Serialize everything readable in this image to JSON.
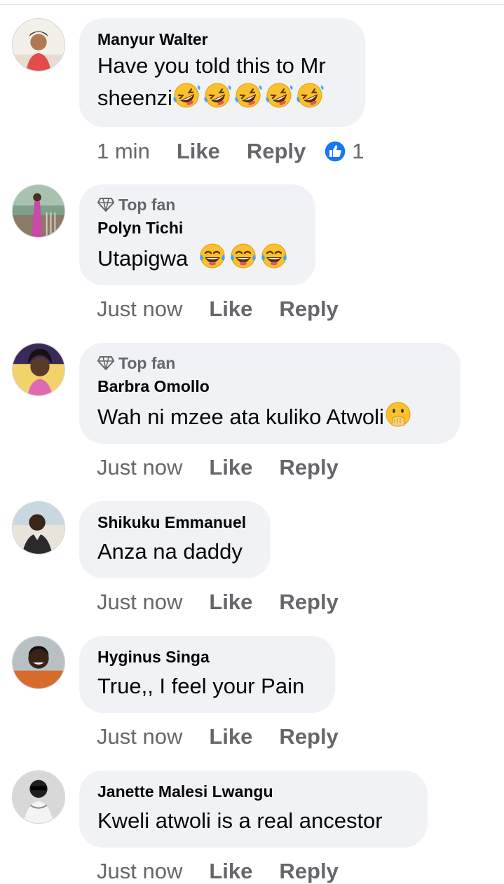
{
  "colors": {
    "bubble": "#f0f2f5",
    "meta_text": "#65676b",
    "name_text": "#050505",
    "like_blue": "#1877f2"
  },
  "comments": [
    {
      "author": "Manyur Walter",
      "top_fan": false,
      "text_lines": [
        "Have you told this to Mr",
        "sheenzi"
      ],
      "emoji": "rolling-on-floor-laughing-icon x5",
      "time": "1 min",
      "like": "Like",
      "reply": "Reply",
      "reactions": "1"
    },
    {
      "author": "Polyn Tichi",
      "top_fan": true,
      "badge": "Top fan",
      "text": "Utapigwa",
      "emoji": "tears-of-joy-icon x3",
      "time": "Just now",
      "like": "Like",
      "reply": "Reply"
    },
    {
      "author": "Barbra Omollo",
      "top_fan": true,
      "badge": "Top fan",
      "text": "Wah ni mzee ata kuliko Atwoli",
      "emoji": "hand-over-mouth-icon",
      "time": "Just now",
      "like": "Like",
      "reply": "Reply"
    },
    {
      "author": "Shikuku Emmanuel",
      "top_fan": false,
      "text": "Anza na daddy",
      "time": "Just now",
      "like": "Like",
      "reply": "Reply"
    },
    {
      "author": "Hyginus Singa",
      "top_fan": false,
      "text": "True,, I feel your Pain",
      "time": "Just now",
      "like": "Like",
      "reply": "Reply"
    },
    {
      "author": "Janette Malesi Lwangu",
      "top_fan": false,
      "text": "Kweli atwoli is a real ancestor",
      "time": "Just now",
      "like": "Like",
      "reply": "Reply"
    }
  ]
}
